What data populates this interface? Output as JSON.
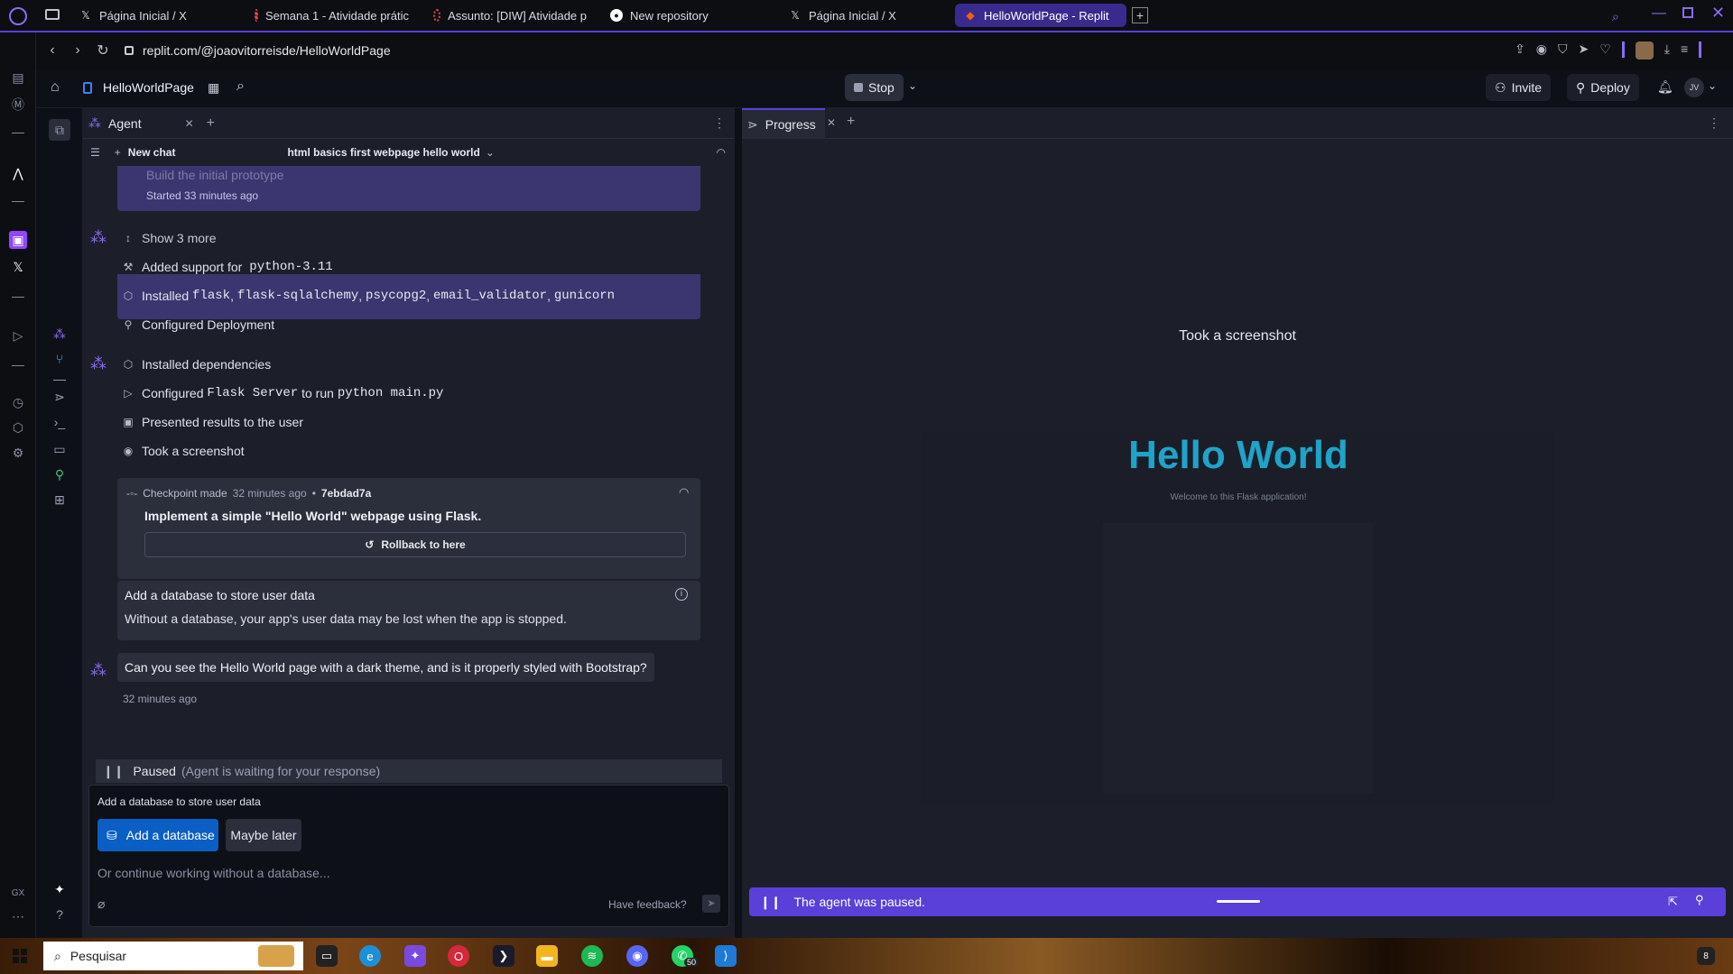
{
  "browser": {
    "tabs": [
      {
        "label": "Página Inicial / X",
        "icon": "x-logo-icon"
      },
      {
        "label": "Semana 1 - Atividade prátic",
        "icon": "loading-icon"
      },
      {
        "label": "Assunto: [DIW] Atividade p",
        "icon": "loading-icon"
      },
      {
        "label": "New repository",
        "icon": "github-icon"
      },
      {
        "label": "Página Inicial / X",
        "icon": "x-logo-icon"
      },
      {
        "label": "HelloWorldPage - Replit",
        "icon": "replit-icon"
      }
    ],
    "url": "replit.com/@joaovitorreisde/HelloWorldPage"
  },
  "replit": {
    "project_name": "HelloWorldPage",
    "stop_label": "Stop",
    "invite_label": "Invite",
    "deploy_label": "Deploy",
    "user_initials": "JV"
  },
  "agent": {
    "tab_label": "Agent",
    "new_chat_label": "New chat",
    "chat_title": "html basics first webpage hello world",
    "prototype_title": "Build the initial prototype",
    "prototype_started": "Started 33 minutes ago",
    "show_more": "Show 3 more",
    "actions_a": [
      {
        "prefix": "Added support for",
        "code": [
          "python-3.11"
        ],
        "icon": "wrench-icon"
      },
      {
        "prefix": "Installed",
        "code": [
          "flask",
          "flask-sqlalchemy",
          "psycopg2",
          "email_validator",
          "gunicorn"
        ],
        "icon": "package-icon"
      },
      {
        "prefix": "Configured Deployment",
        "code": [],
        "icon": "deploy-icon"
      }
    ],
    "actions_b": [
      {
        "text": "Installed dependencies",
        "icon": "package-icon"
      },
      {
        "text": "Configured",
        "code1": "Flask Server",
        "mid": "to run",
        "code2": "python main.py",
        "icon": "play-icon"
      },
      {
        "text": "Presented results to the user",
        "icon": "present-icon"
      },
      {
        "text": "Took a screenshot",
        "icon": "camera-icon"
      }
    ],
    "checkpoint": {
      "label": "Checkpoint made",
      "time": "32 minutes ago",
      "hash": "7ebdad7a",
      "message": "Implement a simple \"Hello World\" webpage using Flask.",
      "rollback_label": "Rollback to here"
    },
    "db_card": {
      "title": "Add a database to store user data",
      "body": "Without a database, your app's user data may be lost when the app is stopped."
    },
    "question": "Can you see the Hello World page with a dark theme, and is it properly styled with Bootstrap?",
    "question_time": "32 minutes ago",
    "paused_label": "Paused",
    "paused_note": "(Agent is waiting for your response)",
    "prompt_title": "Add a database to store user data",
    "add_db_label": "Add a database",
    "maybe_later_label": "Maybe later",
    "input_placeholder": "Or continue working without a database...",
    "feedback_label": "Have feedback?"
  },
  "progress": {
    "tab_label": "Progress",
    "screenshot_label": "Took a screenshot",
    "preview_title": "Hello World",
    "preview_subtitle": "Welcome to this Flask application!",
    "paused_banner": "The agent was paused."
  },
  "taskbar": {
    "search_placeholder": "Pesquisar",
    "badge_whatsapp": "50",
    "badge_notifications": "8"
  },
  "colors": {
    "accent": "#5a3fd8",
    "preview_title": "#1fa3c9",
    "primary_button": "#0b5fc4",
    "banner": "#5a3fd8"
  }
}
